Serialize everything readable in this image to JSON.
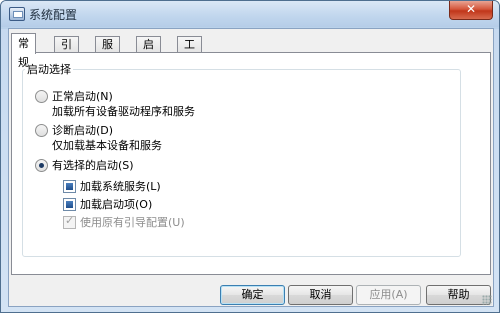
{
  "window": {
    "title": "系统配置",
    "close_label": "✕"
  },
  "tabs": [
    {
      "label": "常规",
      "active": true
    },
    {
      "label": "引导",
      "active": false
    },
    {
      "label": "服务",
      "active": false
    },
    {
      "label": "启动",
      "active": false
    },
    {
      "label": "工具",
      "active": false
    }
  ],
  "startup_group": {
    "legend": "启动选择",
    "normal": {
      "label": "正常启动(N)",
      "description": "加载所有设备驱动程序和服务",
      "selected": false
    },
    "diagnostic": {
      "label": "诊断启动(D)",
      "description": "仅加载基本设备和服务",
      "selected": false
    },
    "selective": {
      "label": "有选择的启动(S)",
      "selected": true,
      "options": {
        "load_system_services": {
          "label": "加载系统服务(L)",
          "checked": true,
          "enabled": true
        },
        "load_startup_items": {
          "label": "加载启动项(O)",
          "checked": true,
          "enabled": true
        },
        "use_original_boot_config": {
          "label": "使用原有引导配置(U)",
          "checked": true,
          "enabled": false
        }
      }
    }
  },
  "buttons": {
    "ok": "确定",
    "cancel": "取消",
    "apply": "应用(A)",
    "help": "帮助"
  }
}
